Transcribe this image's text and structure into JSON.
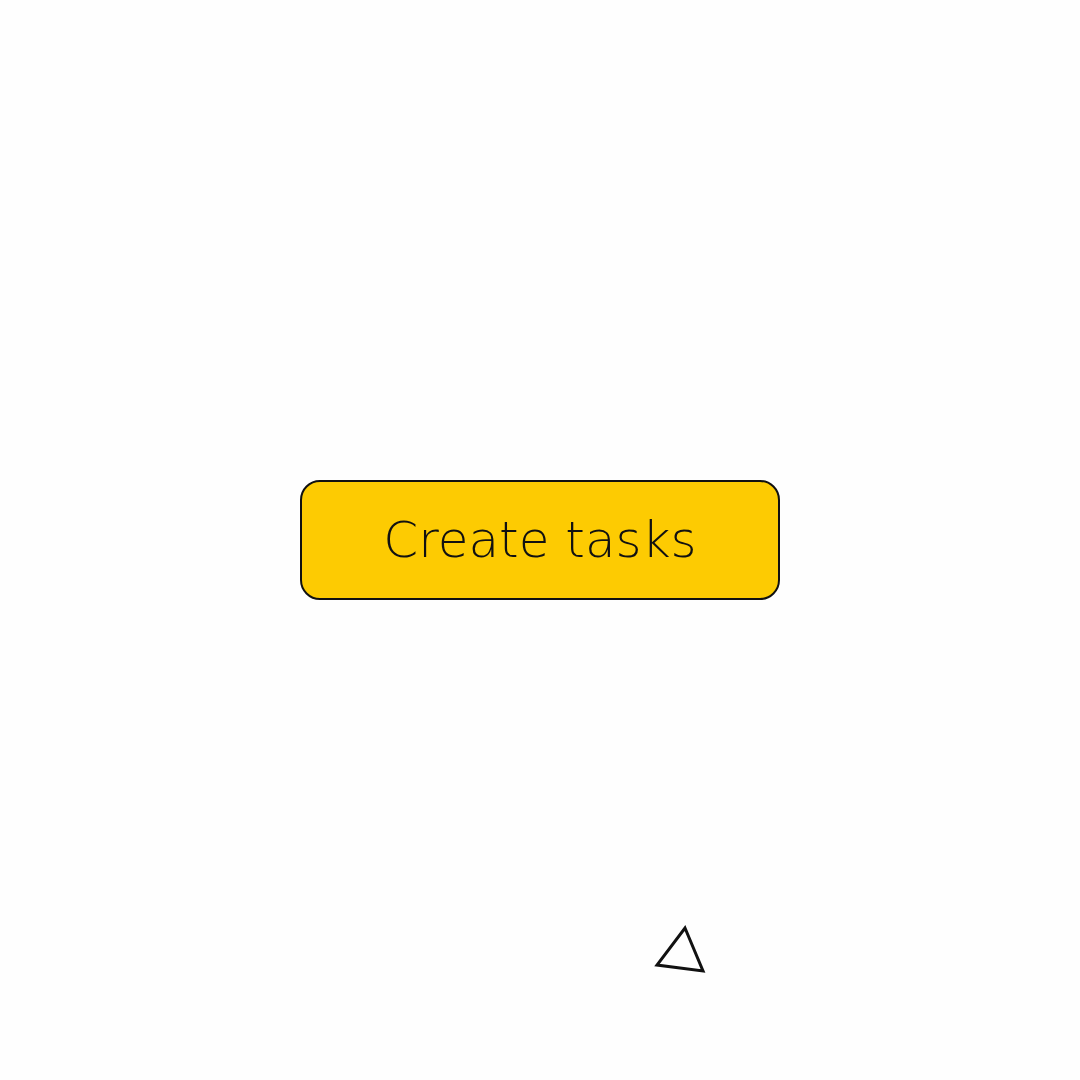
{
  "button": {
    "label": "Create tasks"
  }
}
